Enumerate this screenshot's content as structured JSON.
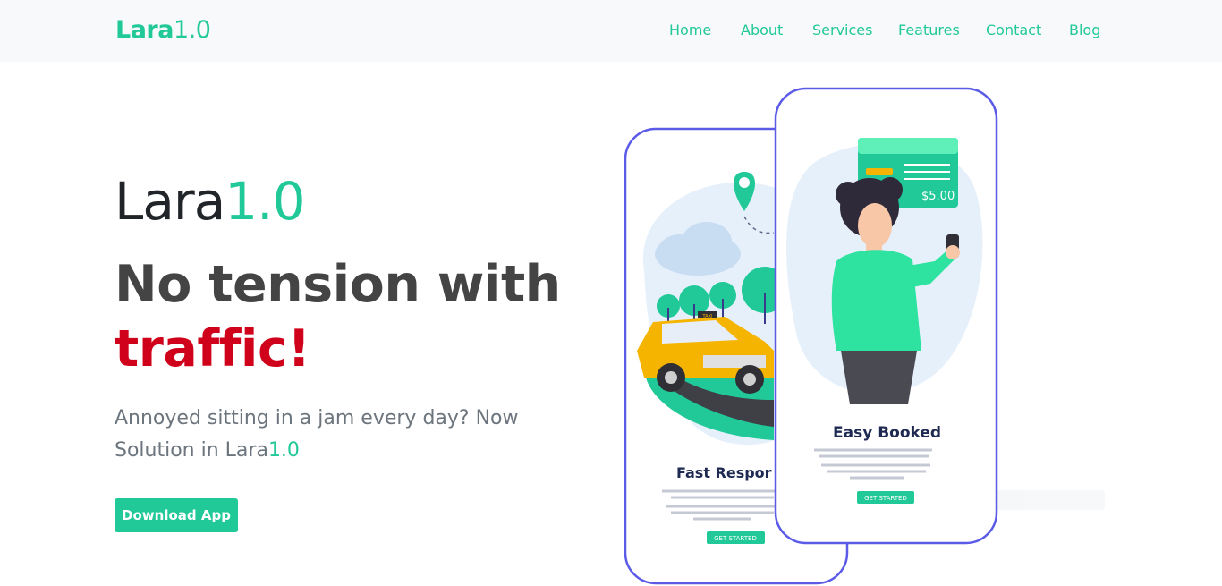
{
  "header": {
    "brand_strong": "Lara",
    "brand_light": "1.0",
    "nav": [
      "Home",
      "About",
      "Services",
      "Features",
      "Contact",
      "Blog"
    ]
  },
  "hero": {
    "title_main": "Lara",
    "title_accent": "1.0",
    "headline_line1": "No tension with",
    "headline_line2": "traffic!",
    "subtitle_text": "Annoyed sitting in a jam every day? Now Solution in Lara",
    "subtitle_accent": "1.0",
    "download_label": "Download App"
  },
  "illustration": {
    "card_price": "$5.00",
    "back_phone_title": "Fast Respor",
    "back_phone_button": "GET STARTED",
    "front_phone_title": "Easy Booked",
    "front_phone_button": "GET STARTED",
    "body_text": "Lorem ipsum dolor sit amet consectetur adipiscing elit",
    "taxi_sign": "TAXI"
  },
  "colors": {
    "accent": "#20c997",
    "headline_red": "#d0021b",
    "phone_outline": "#5b5be8"
  }
}
